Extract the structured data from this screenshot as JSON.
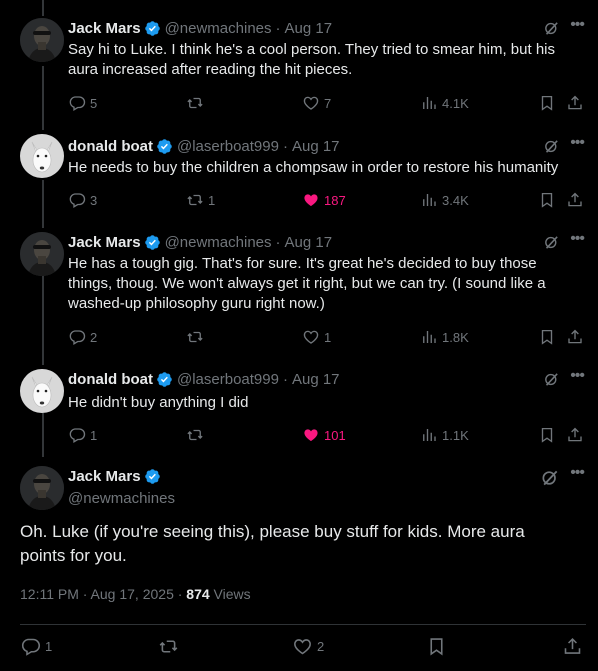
{
  "colors": {
    "verified": "#1d9bf0",
    "like": "#f91880",
    "muted": "#71767b",
    "text": "#e7e9ea"
  },
  "tweets": [
    {
      "name": "Jack Mars",
      "handle": "@newmachines",
      "date": "Aug 17",
      "text": "Say hi to Luke. I think he's a cool person. They tried to smear him, but his aura increased after reading the hit pieces.",
      "replies": "5",
      "retweets": "",
      "likes": "7",
      "views": "4.1K",
      "liked": false
    },
    {
      "name": "donald boat",
      "handle": "@laserboat999",
      "date": "Aug 17",
      "text": "He needs to buy the children a chompsaw in order to restore his humanity",
      "replies": "3",
      "retweets": "1",
      "likes": "187",
      "views": "3.4K",
      "liked": true
    },
    {
      "name": "Jack Mars",
      "handle": "@newmachines",
      "date": "Aug 17",
      "text": "He has a tough gig. That's for sure. It's great he's decided to buy those things, thoug. We won't always get it right, but we can try. (I sound like a washed-up philosophy guru right now.)",
      "replies": "2",
      "retweets": "",
      "likes": "1",
      "views": "1.8K",
      "liked": false
    },
    {
      "name": "donald boat",
      "handle": "@laserboat999",
      "date": "Aug 17",
      "text": "He didn't buy anything I did",
      "replies": "1",
      "retweets": "",
      "likes": "101",
      "views": "1.1K",
      "liked": true
    }
  ],
  "main_tweet": {
    "name": "Jack Mars",
    "handle": "@newmachines",
    "text": "Oh. Luke (if you're seeing this), please buy stuff for kids. More aura points for you.",
    "timestamp": "12:11 PM · Aug 17, 2025 · ",
    "views_count": "874",
    "views_label": " Views",
    "replies": "1",
    "retweets": "",
    "likes": "2"
  },
  "separator": "·",
  "more_glyph": "•••"
}
